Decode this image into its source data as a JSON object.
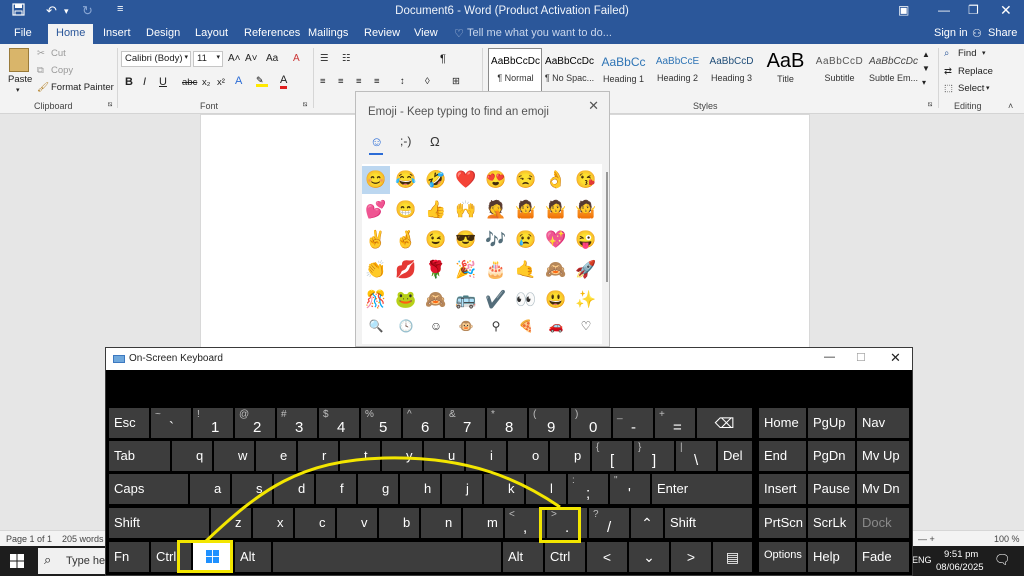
{
  "titlebar": {
    "title": "Document6 - Word (Product Activation Failed)",
    "save_icon": "save-icon",
    "undo": "↶",
    "redo": "↻",
    "customize": "≡"
  },
  "tabs": [
    "File",
    "Home",
    "Insert",
    "Design",
    "Layout",
    "References",
    "Mailings",
    "Review",
    "View"
  ],
  "tellme": "Tell me what you want to do...",
  "signin": "Sign in",
  "share": "Share",
  "clipboard": {
    "paste": "Paste",
    "cut": "Cut",
    "copy": "Copy",
    "format_painter": "Format Painter",
    "label": "Clipboard"
  },
  "font": {
    "name": "Calibri (Body)",
    "size": "11",
    "label": "Font",
    "bold": "B",
    "italic": "I",
    "underline": "U",
    "strike": "abc",
    "sub": "x₂",
    "sup": "x²",
    "grow": "A˄",
    "shrink": "A˅",
    "case": "Aa",
    "clear": "A"
  },
  "paragraph": {
    "label": "Paragraph",
    "pilcrow": "¶"
  },
  "styles": {
    "label": "Styles",
    "items": [
      {
        "preview": "AaBbCcDc",
        "name": "¶ Normal"
      },
      {
        "preview": "AaBbCcDc",
        "name": "¶ No Spac..."
      },
      {
        "preview": "AaBbCc",
        "name": "Heading 1"
      },
      {
        "preview": "AaBbCcE",
        "name": "Heading 2"
      },
      {
        "preview": "AaBbCcD",
        "name": "Heading 3"
      },
      {
        "preview": "AaB",
        "name": "Title"
      },
      {
        "preview": "AaBbCcD",
        "name": "Subtitle"
      },
      {
        "preview": "AaBbCcDc",
        "name": "Subtle Em..."
      }
    ]
  },
  "editing": {
    "find": "Find",
    "replace": "Replace",
    "select": "Select",
    "label": "Editing"
  },
  "status": {
    "page": "Page 1 of 1",
    "words": "205 words",
    "zoom": "100 %"
  },
  "emoji_panel": {
    "header": "Emoji - Keep typing to find an emoji",
    "tabs": [
      "☺",
      ";-)",
      "Ω"
    ],
    "rows": [
      [
        "😊",
        "😂",
        "🤣",
        "❤️",
        "😍",
        "😒",
        "👌",
        "😘"
      ],
      [
        "💕",
        "😁",
        "👍",
        "🙌",
        "🤦",
        "🤷",
        "🤷",
        "🤷"
      ],
      [
        "✌️",
        "🤞",
        "😉",
        "😎",
        "🎶",
        "😢",
        "💖",
        "😜"
      ],
      [
        "👏",
        "💋",
        "🌹",
        "🎉",
        "🎂",
        "🤙",
        "🙈",
        "🚀"
      ],
      [
        "🎊",
        "🐸",
        "🙈",
        "🚌",
        "✔️",
        "👀",
        "😃",
        "✨"
      ]
    ],
    "categories": [
      "🔍",
      "🕓",
      "☺",
      "🐵",
      "⚲",
      "🍕",
      "🚗",
      "♡"
    ]
  },
  "osk": {
    "title": "On-Screen Keyboard",
    "rows": {
      "r1": [
        [
          "~",
          "`"
        ],
        [
          "!",
          "1"
        ],
        [
          "@",
          "2"
        ],
        [
          "#",
          "3"
        ],
        [
          "$",
          "4"
        ],
        [
          "%",
          "5"
        ],
        [
          "^",
          "6"
        ],
        [
          "&",
          "7"
        ],
        [
          "*",
          "8"
        ],
        [
          "(",
          "9"
        ],
        [
          ")",
          "0"
        ],
        [
          "_",
          "-"
        ],
        [
          "+",
          "="
        ]
      ],
      "r2": [
        "q",
        "w",
        "e",
        "r",
        "t",
        "y",
        "u",
        "i",
        "o",
        "p"
      ],
      "r2b": [
        [
          "{",
          "["
        ],
        [
          "}",
          "]"
        ],
        [
          "|",
          "\\"
        ]
      ],
      "r3": [
        "a",
        "s",
        "d",
        "f",
        "g",
        "h",
        "j",
        "k",
        "l"
      ],
      "r3b": [
        [
          ":",
          ";"
        ],
        [
          "\"",
          "'"
        ]
      ],
      "r4": [
        "z",
        "x",
        "c",
        "v",
        "b",
        "n",
        "m"
      ],
      "r4b": [
        [
          "<",
          ","
        ],
        [
          ">",
          "."
        ],
        [
          "?",
          "/"
        ]
      ]
    },
    "labels": {
      "esc": "Esc",
      "tab": "Tab",
      "caps": "Caps",
      "shift": "Shift",
      "fn": "Fn",
      "ctrl": "Ctrl",
      "alt": "Alt",
      "del": "Del",
      "enter": "Enter",
      "shift_r": "Shift",
      "alt_r": "Alt",
      "ctrl_r": "Ctrl",
      "home": "Home",
      "pgup": "PgUp",
      "nav": "Nav",
      "end": "End",
      "pgdn": "PgDn",
      "mvup": "Mv Up",
      "insert": "Insert",
      "pause": "Pause",
      "mvdn": "Mv Dn",
      "prtscn": "PrtScn",
      "scrlk": "ScrLk",
      "dock": "Dock",
      "options": "Options",
      "help": "Help",
      "fade": "Fade",
      "backspace": "⌫"
    }
  },
  "taskbar": {
    "search": "Type he",
    "lang": "ENG",
    "time": "9:51 pm",
    "date": "08/06/2025"
  },
  "colors": {
    "word_blue": "#2b579a",
    "highlight": "#f3e600",
    "key": "#3d3d3d"
  }
}
